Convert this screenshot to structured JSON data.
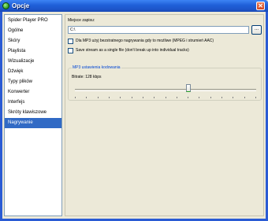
{
  "window": {
    "title": "Opcje"
  },
  "sidebar": {
    "items": [
      {
        "label": "Spider Player PRO"
      },
      {
        "label": "Ogólne"
      },
      {
        "label": "Skóry"
      },
      {
        "label": "Playlista"
      },
      {
        "label": "Wizualizacje"
      },
      {
        "label": "Dźwięk"
      },
      {
        "label": "Typy plików"
      },
      {
        "label": "Konwerter"
      },
      {
        "label": "Interfejs"
      },
      {
        "label": "Skróty klawiszowe"
      },
      {
        "label": "Nagrywanie"
      }
    ],
    "selected": "Nagrywanie"
  },
  "recording": {
    "save_location_label": "Miejsce zapisu:",
    "save_location_value": "C:\\",
    "browse_label": "...",
    "option_mp3": "Dla MP3 użyj bezstratnego nagrywania gdy to możliwe (MPEG i strumień AAC)",
    "option_single_file": "Save stream as a single file (don't break up into individual tracks)",
    "mp3_group_title": "MP3 ustawienia kodowania",
    "bitrate_label": "Bitrate: 128 kbps",
    "bitrate_slider_fraction": 0.625,
    "slider_tick_count": 17
  }
}
